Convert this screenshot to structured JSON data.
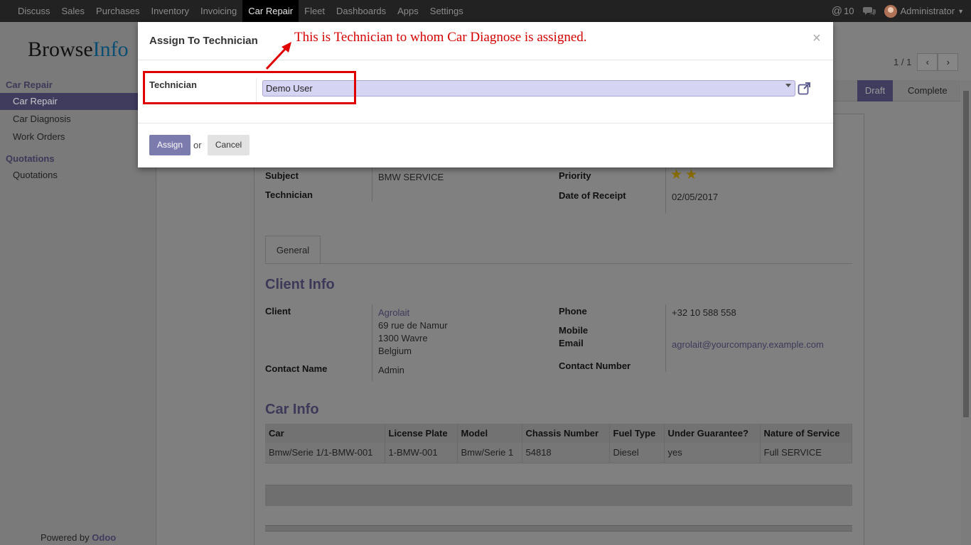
{
  "topbar": {
    "menu": [
      "Discuss",
      "Sales",
      "Purchases",
      "Inventory",
      "Invoicing",
      "Car Repair",
      "Fleet",
      "Dashboards",
      "Apps",
      "Settings"
    ],
    "active_menu": "Car Repair",
    "mentions_count": "10",
    "user": "Administrator"
  },
  "brand": {
    "part1": "Browse",
    "part2": "Info"
  },
  "sidebar": {
    "section1": "Car Repair",
    "items1": [
      "Car Repair",
      "Car Diagnosis",
      "Work Orders"
    ],
    "section2": "Quotations",
    "items2": [
      "Quotations"
    ],
    "powered_by": "Powered by",
    "powered_brand": "Odoo"
  },
  "pager": {
    "counter": "1 / 1",
    "prev": "‹",
    "next": "›"
  },
  "status": {
    "draft": "Draft",
    "complete": "Complete"
  },
  "form": {
    "subject_label": "Subject",
    "subject_value": "BMW SERVICE",
    "technician_label": "Technician",
    "priority_label": "Priority",
    "priority_stars": 2,
    "date_label": "Date of Receipt",
    "date_value": "02/05/2017",
    "tab_general": "General",
    "client_info_heading": "Client Info",
    "client_label": "Client",
    "client_name": "Agrolait",
    "client_addr1": "69 rue de Namur",
    "client_addr2": "1300 Wavre",
    "client_addr3": "Belgium",
    "contact_name_label": "Contact Name",
    "contact_name_value": "Admin",
    "phone_label": "Phone",
    "phone_value": "+32 10 588 558",
    "mobile_label": "Mobile",
    "email_label": "Email",
    "email_value": "agrolait@yourcompany.example.com",
    "contact_number_label": "Contact Number",
    "car_info_heading": "Car Info"
  },
  "car_table": {
    "headers": [
      "Car",
      "License Plate",
      "Model",
      "Chassis Number",
      "Fuel Type",
      "Under Guarantee?",
      "Nature of Service"
    ],
    "row": [
      "Bmw/Serie 1/1-BMW-001",
      "1-BMW-001",
      "Bmw/Serie 1",
      "54818",
      "Diesel",
      "yes",
      "Full SERVICE"
    ]
  },
  "modal": {
    "title": "Assign To Technician",
    "close": "×",
    "technician_label": "Technician",
    "technician_value": "Demo User",
    "assign_button": "Assign",
    "or_text": "or",
    "cancel_button": "Cancel"
  },
  "annotation": "This is Technician to whom Car Diagnose is assigned.",
  "colors": {
    "accent": "#7c7bad",
    "annotation": "#d40000",
    "navbar": "#222222"
  }
}
